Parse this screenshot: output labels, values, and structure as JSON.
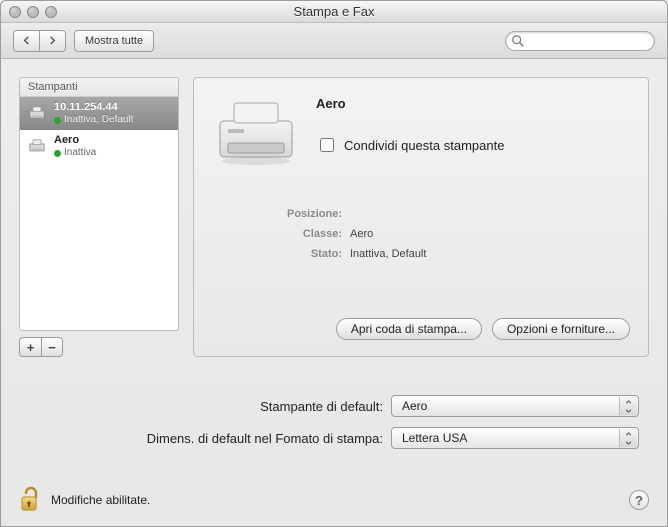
{
  "window": {
    "title": "Stampa e Fax"
  },
  "toolbar": {
    "show_all": "Mostra tutte",
    "search_placeholder": ""
  },
  "sidebar": {
    "header": "Stampanti",
    "items": [
      {
        "name": "10.11.254.44",
        "status": "Inattiva, Default",
        "selected": true
      },
      {
        "name": "Aero",
        "status": "Inattiva",
        "selected": false
      }
    ],
    "add_label": "+",
    "remove_label": "−"
  },
  "detail": {
    "name": "Aero",
    "share_label": "Condividi questa stampante",
    "share_checked": false,
    "fields": {
      "location_label": "Posizione:",
      "location_value": "",
      "class_label": "Classe:",
      "class_value": "Aero",
      "state_label": "Stato:",
      "state_value": "Inattiva, Default"
    },
    "open_queue": "Apri coda di stampa...",
    "options": "Opzioni e forniture..."
  },
  "defaults": {
    "default_printer_label": "Stampante di default:",
    "default_printer_value": "Aero",
    "default_paper_label": "Dimens. di default nel Fomato di stampa:",
    "default_paper_value": "Lettera USA"
  },
  "footer": {
    "lock_text": "Modifiche abilitate.",
    "help": "?"
  }
}
